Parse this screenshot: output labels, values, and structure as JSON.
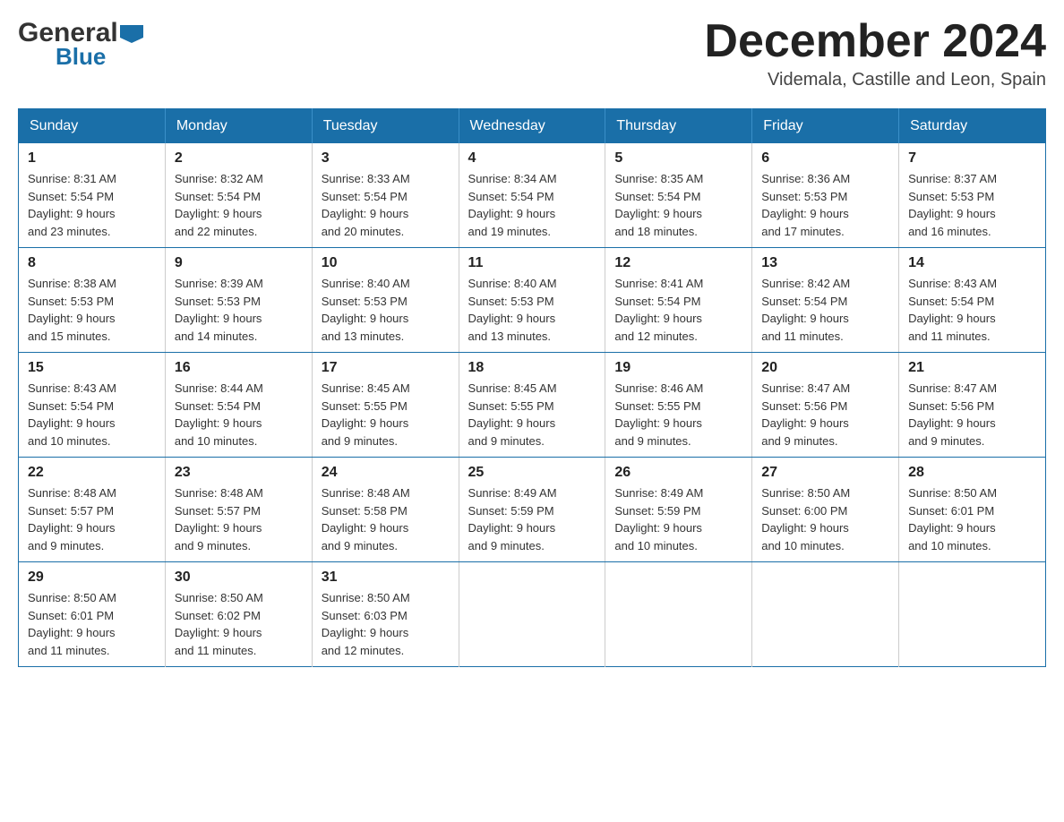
{
  "header": {
    "logo_general": "General",
    "logo_blue": "Blue",
    "month_title": "December 2024",
    "location": "Videmala, Castille and Leon, Spain"
  },
  "days_of_week": [
    "Sunday",
    "Monday",
    "Tuesday",
    "Wednesday",
    "Thursday",
    "Friday",
    "Saturday"
  ],
  "weeks": [
    [
      {
        "day": "1",
        "sunrise": "8:31 AM",
        "sunset": "5:54 PM",
        "daylight": "9 hours and 23 minutes."
      },
      {
        "day": "2",
        "sunrise": "8:32 AM",
        "sunset": "5:54 PM",
        "daylight": "9 hours and 22 minutes."
      },
      {
        "day": "3",
        "sunrise": "8:33 AM",
        "sunset": "5:54 PM",
        "daylight": "9 hours and 20 minutes."
      },
      {
        "day": "4",
        "sunrise": "8:34 AM",
        "sunset": "5:54 PM",
        "daylight": "9 hours and 19 minutes."
      },
      {
        "day": "5",
        "sunrise": "8:35 AM",
        "sunset": "5:54 PM",
        "daylight": "9 hours and 18 minutes."
      },
      {
        "day": "6",
        "sunrise": "8:36 AM",
        "sunset": "5:53 PM",
        "daylight": "9 hours and 17 minutes."
      },
      {
        "day": "7",
        "sunrise": "8:37 AM",
        "sunset": "5:53 PM",
        "daylight": "9 hours and 16 minutes."
      }
    ],
    [
      {
        "day": "8",
        "sunrise": "8:38 AM",
        "sunset": "5:53 PM",
        "daylight": "9 hours and 15 minutes."
      },
      {
        "day": "9",
        "sunrise": "8:39 AM",
        "sunset": "5:53 PM",
        "daylight": "9 hours and 14 minutes."
      },
      {
        "day": "10",
        "sunrise": "8:40 AM",
        "sunset": "5:53 PM",
        "daylight": "9 hours and 13 minutes."
      },
      {
        "day": "11",
        "sunrise": "8:40 AM",
        "sunset": "5:53 PM",
        "daylight": "9 hours and 13 minutes."
      },
      {
        "day": "12",
        "sunrise": "8:41 AM",
        "sunset": "5:54 PM",
        "daylight": "9 hours and 12 minutes."
      },
      {
        "day": "13",
        "sunrise": "8:42 AM",
        "sunset": "5:54 PM",
        "daylight": "9 hours and 11 minutes."
      },
      {
        "day": "14",
        "sunrise": "8:43 AM",
        "sunset": "5:54 PM",
        "daylight": "9 hours and 11 minutes."
      }
    ],
    [
      {
        "day": "15",
        "sunrise": "8:43 AM",
        "sunset": "5:54 PM",
        "daylight": "9 hours and 10 minutes."
      },
      {
        "day": "16",
        "sunrise": "8:44 AM",
        "sunset": "5:54 PM",
        "daylight": "9 hours and 10 minutes."
      },
      {
        "day": "17",
        "sunrise": "8:45 AM",
        "sunset": "5:55 PM",
        "daylight": "9 hours and 9 minutes."
      },
      {
        "day": "18",
        "sunrise": "8:45 AM",
        "sunset": "5:55 PM",
        "daylight": "9 hours and 9 minutes."
      },
      {
        "day": "19",
        "sunrise": "8:46 AM",
        "sunset": "5:55 PM",
        "daylight": "9 hours and 9 minutes."
      },
      {
        "day": "20",
        "sunrise": "8:47 AM",
        "sunset": "5:56 PM",
        "daylight": "9 hours and 9 minutes."
      },
      {
        "day": "21",
        "sunrise": "8:47 AM",
        "sunset": "5:56 PM",
        "daylight": "9 hours and 9 minutes."
      }
    ],
    [
      {
        "day": "22",
        "sunrise": "8:48 AM",
        "sunset": "5:57 PM",
        "daylight": "9 hours and 9 minutes."
      },
      {
        "day": "23",
        "sunrise": "8:48 AM",
        "sunset": "5:57 PM",
        "daylight": "9 hours and 9 minutes."
      },
      {
        "day": "24",
        "sunrise": "8:48 AM",
        "sunset": "5:58 PM",
        "daylight": "9 hours and 9 minutes."
      },
      {
        "day": "25",
        "sunrise": "8:49 AM",
        "sunset": "5:59 PM",
        "daylight": "9 hours and 9 minutes."
      },
      {
        "day": "26",
        "sunrise": "8:49 AM",
        "sunset": "5:59 PM",
        "daylight": "9 hours and 10 minutes."
      },
      {
        "day": "27",
        "sunrise": "8:50 AM",
        "sunset": "6:00 PM",
        "daylight": "9 hours and 10 minutes."
      },
      {
        "day": "28",
        "sunrise": "8:50 AM",
        "sunset": "6:01 PM",
        "daylight": "9 hours and 10 minutes."
      }
    ],
    [
      {
        "day": "29",
        "sunrise": "8:50 AM",
        "sunset": "6:01 PM",
        "daylight": "9 hours and 11 minutes."
      },
      {
        "day": "30",
        "sunrise": "8:50 AM",
        "sunset": "6:02 PM",
        "daylight": "9 hours and 11 minutes."
      },
      {
        "day": "31",
        "sunrise": "8:50 AM",
        "sunset": "6:03 PM",
        "daylight": "9 hours and 12 minutes."
      },
      null,
      null,
      null,
      null
    ]
  ],
  "labels": {
    "sunrise": "Sunrise:",
    "sunset": "Sunset:",
    "daylight": "Daylight:"
  }
}
